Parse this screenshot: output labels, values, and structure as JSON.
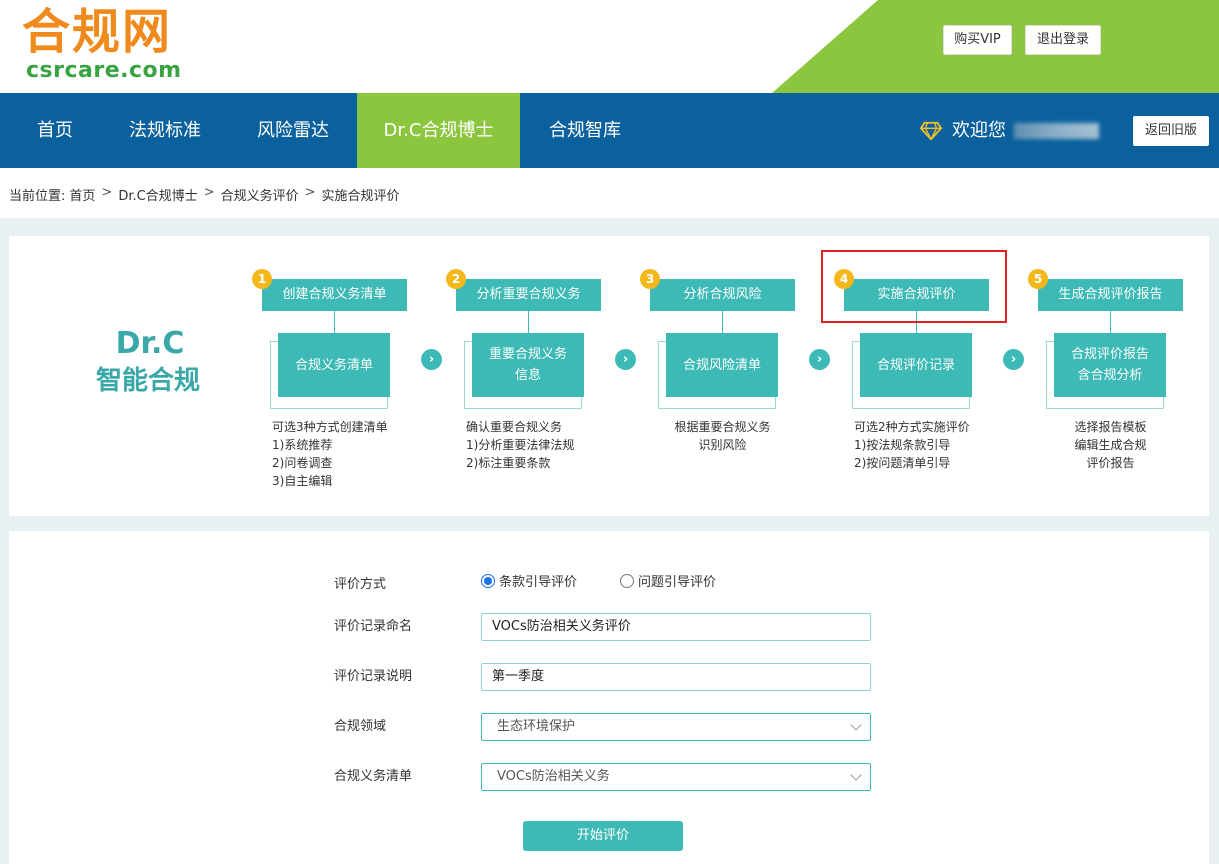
{
  "header": {
    "logo_cn": "合规网",
    "logo_en": "csrcare.com",
    "buy_vip": "购买VIP",
    "logout": "退出登录"
  },
  "nav": {
    "items": [
      {
        "label": "首页"
      },
      {
        "label": "法规标准"
      },
      {
        "label": "风险雷达"
      },
      {
        "label": "Dr.C合规博士",
        "active": true
      },
      {
        "label": "合规智库"
      }
    ],
    "welcome": "欢迎您",
    "old_version": "返回旧版"
  },
  "breadcrumb": {
    "prefix": "当前位置:",
    "items": [
      "首页",
      "Dr.C合规博士",
      "合规义务评价",
      "实施合规评价"
    ],
    "separator": ">"
  },
  "brand": {
    "title": "Dr.C",
    "subtitle": "智能合规"
  },
  "steps": [
    {
      "num": "1",
      "head": "创建合规义务清单",
      "doc": "合规义务清单",
      "desc": [
        "可选3种方式创建清单",
        "1)系统推荐",
        "2)问卷调查",
        "3)自主编辑"
      ]
    },
    {
      "num": "2",
      "head": "分析重要合规义务",
      "doc": "重要合规义务信息",
      "desc": [
        "确认重要合规义务",
        "1)分析重要法律法规",
        "2)标注重要条款"
      ]
    },
    {
      "num": "3",
      "head": "分析合规风险",
      "doc": "合规风险清单",
      "desc": [
        "根据重要合规义务",
        "识别风险"
      ]
    },
    {
      "num": "4",
      "head": "实施合规评价",
      "doc": "合规评价记录",
      "desc": [
        "可选2种方式实施评价",
        "1)按法规条款引导",
        "2)按问题清单引导"
      ],
      "highlighted": true
    },
    {
      "num": "5",
      "head": "生成合规评价报告",
      "doc": "合规评价报告含合规分析",
      "desc": [
        "选择报告模板",
        "编辑生成合规",
        "评价报告"
      ]
    }
  ],
  "form": {
    "method_label": "评价方式",
    "method_options": [
      {
        "label": "条款引导评价",
        "selected": true
      },
      {
        "label": "问题引导评价",
        "selected": false
      }
    ],
    "name_label": "评价记录命名",
    "name_value": "VOCs防治相关义务评价",
    "desc_label": "评价记录说明",
    "desc_value": "第一季度",
    "domain_label": "合规领域",
    "domain_value": "生态环境保护",
    "list_label": "合规义务清单",
    "list_value": "VOCs防治相关义务",
    "start_button": "开始评价"
  },
  "colors": {
    "nav_blue": "#0a619d",
    "accent_green": "#8cc63f",
    "teal": "#3dbab5",
    "logo_orange": "#f08a1c",
    "step_number": "#f5b81c",
    "highlight_red": "#e02020"
  }
}
